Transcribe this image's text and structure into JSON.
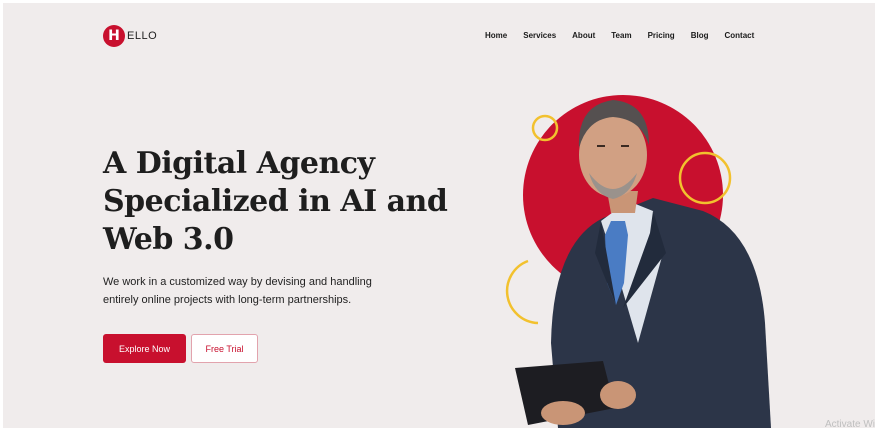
{
  "brand": {
    "badge_letter": "H",
    "name": "ELLO",
    "accent": "#c8102e"
  },
  "nav": {
    "items": [
      "Home",
      "Services",
      "About",
      "Team",
      "Pricing",
      "Blog",
      "Contact"
    ]
  },
  "hero": {
    "title_line1": "A Digital Agency",
    "title_line2": "Specialized in AI and",
    "title_line3": "Web 3.0",
    "desc_line1": "We work in a customized way by devising and handling",
    "desc_line2": "entirely online projects with long-term partnerships.",
    "primary_label": "Explore Now",
    "secondary_label": "Free Trial"
  },
  "watermark": {
    "text": "Activate Wi"
  }
}
